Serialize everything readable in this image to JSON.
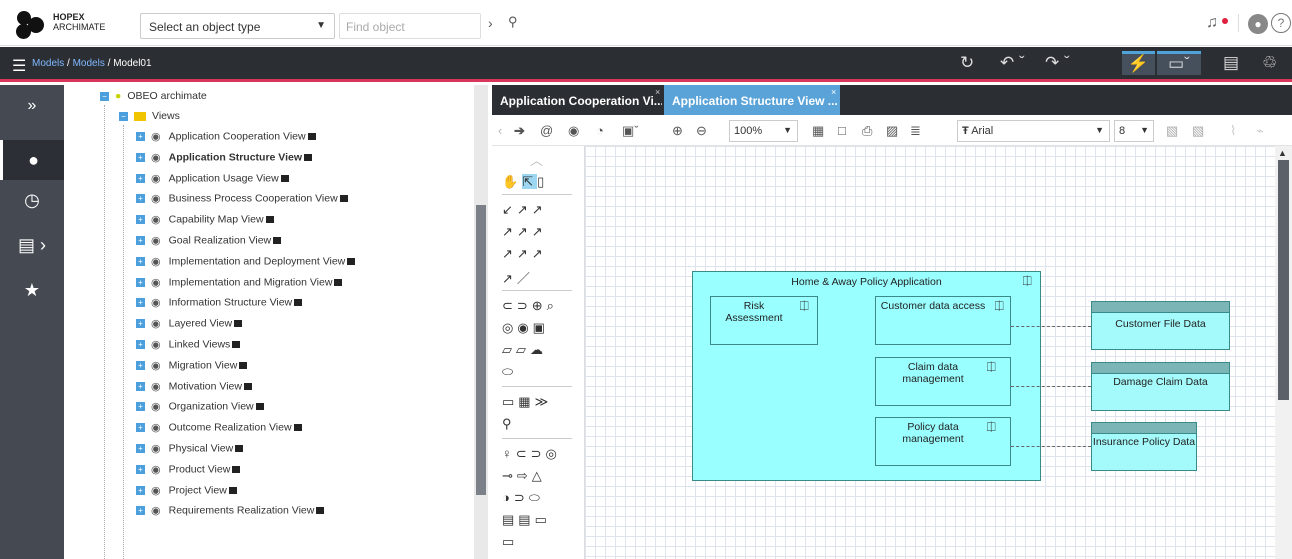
{
  "app": {
    "brand_line1": "HOPEX",
    "brand_line2": "ARCHIMATE"
  },
  "search": {
    "object_type_placeholder": "Select an object type",
    "find_placeholder": "Find object"
  },
  "breadcrumb": {
    "part1": "Models",
    "sep": " / ",
    "part2": "Models",
    "part3": "Model01"
  },
  "tree": {
    "root": "OBEO archimate",
    "folder": "Views",
    "items": [
      {
        "label": "Application Cooperation View"
      },
      {
        "label": "Application Structure View"
      },
      {
        "label": "Application Usage View"
      },
      {
        "label": "Business Process Cooperation View"
      },
      {
        "label": "Capability Map View"
      },
      {
        "label": "Goal Realization View"
      },
      {
        "label": "Implementation and Deployment View"
      },
      {
        "label": "Implementation and Migration View"
      },
      {
        "label": "Information Structure View"
      },
      {
        "label": "Layered View"
      },
      {
        "label": "Linked Views"
      },
      {
        "label": "Migration View"
      },
      {
        "label": "Motivation View"
      },
      {
        "label": "Organization View"
      },
      {
        "label": "Outcome Realization View"
      },
      {
        "label": "Physical View"
      },
      {
        "label": "Product View"
      },
      {
        "label": "Project View"
      },
      {
        "label": "Requirements Realization View"
      }
    ]
  },
  "tabs": [
    {
      "label": "Application Cooperation Vi..."
    },
    {
      "label": "Application Structure View ..."
    }
  ],
  "editor": {
    "zoom": "100%",
    "font": "Arial",
    "font_size": "8"
  },
  "diagram": {
    "container": "Home & Away Policy Application",
    "components": [
      {
        "label": "Risk Assessment"
      },
      {
        "label": "Customer data access"
      },
      {
        "label": "Claim data management"
      },
      {
        "label": "Policy data management"
      }
    ],
    "data_objects": [
      {
        "label": "Customer File Data"
      },
      {
        "label": "Damage Claim Data"
      },
      {
        "label": "Insurance Policy Data"
      }
    ]
  },
  "colors": {
    "accent": "#d9365b",
    "tab_active": "#5aa3d9",
    "component_fill": "#99ffff",
    "dark_bar": "#2b2e33"
  }
}
